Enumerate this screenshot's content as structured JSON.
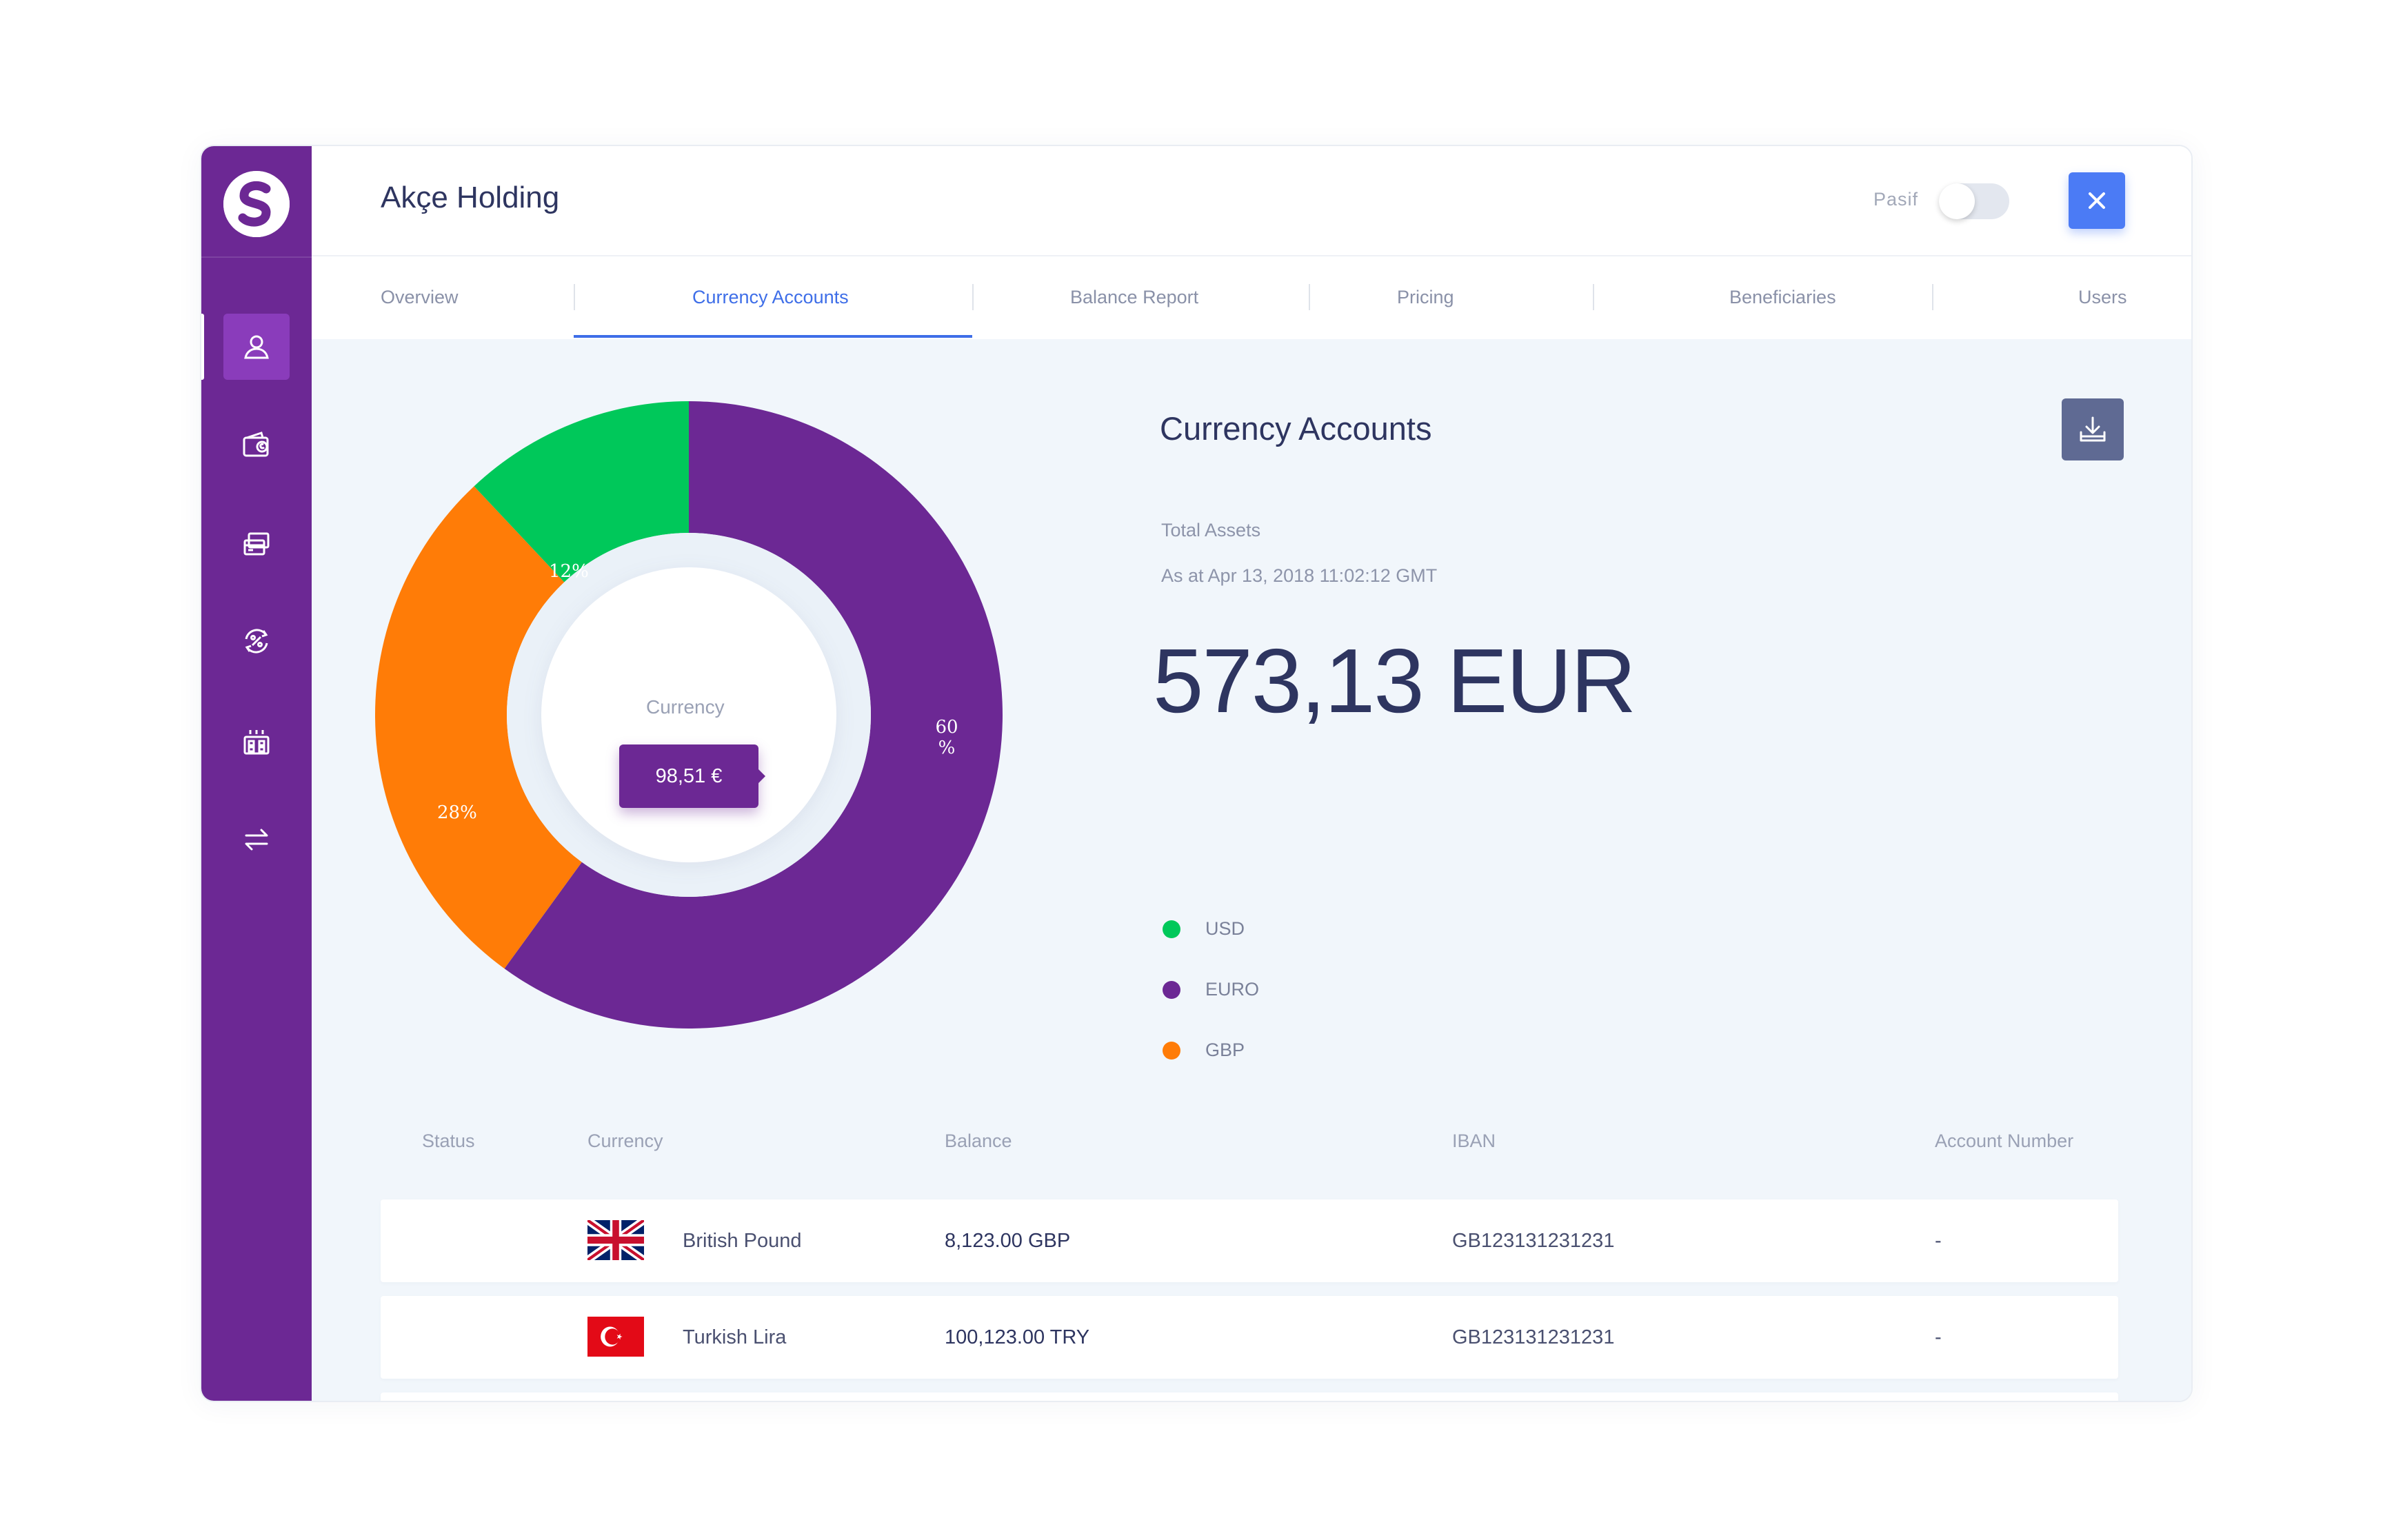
{
  "app": {
    "company_name": "Akçe Holding",
    "status_label": "Pasif",
    "status_active": false
  },
  "sidebar": {
    "items": [
      {
        "icon": "user-icon",
        "active": true
      },
      {
        "icon": "wallet-icon",
        "active": false
      },
      {
        "icon": "cards-icon",
        "active": false
      },
      {
        "icon": "percent-exchange-icon",
        "active": false
      },
      {
        "icon": "building-icon",
        "active": false
      },
      {
        "icon": "transfer-arrows-icon",
        "active": false
      }
    ]
  },
  "tabs": [
    {
      "label": "Overview",
      "active": false
    },
    {
      "label": "Currency Accounts",
      "active": true
    },
    {
      "label": "Balance Report",
      "active": false
    },
    {
      "label": "Pricing",
      "active": false
    },
    {
      "label": "Beneficiaries",
      "active": false
    },
    {
      "label": "Users",
      "active": false
    }
  ],
  "panel": {
    "title": "Currency Accounts",
    "total_assets_label": "Total Assets",
    "as_at": "As at Apr 13, 2018 11:02:12 GMT",
    "total_amount": "573,13 EUR",
    "legend": [
      {
        "label": "USD",
        "color": "#00c85a"
      },
      {
        "label": "EURO",
        "color": "#6c2894"
      },
      {
        "label": "GBP",
        "color": "#ff7c07"
      }
    ]
  },
  "donut": {
    "center_caption": "Currency",
    "center_value": "98,51 €",
    "slices": [
      {
        "name": "EURO",
        "value": 60,
        "color": "#6c2894",
        "label_line1": "60",
        "label_line2": "%"
      },
      {
        "name": "GBP",
        "value": 28,
        "color": "#ff7c07",
        "label_line1": "28%",
        "label_line2": ""
      },
      {
        "name": "USD",
        "value": 12,
        "color": "#00c85a",
        "label_line1": "12%",
        "label_line2": ""
      }
    ]
  },
  "table": {
    "headers": [
      "Status",
      "Currency",
      "Balance",
      "IBAN",
      "Account Number"
    ],
    "rows": [
      {
        "currency": "British Pound",
        "flag": "uk-flag-icon",
        "balance": "8,123.00 GBP",
        "iban": "GB123131231231",
        "account_number": "-"
      },
      {
        "currency": "Turkish Lira",
        "flag": "turkey-flag-icon",
        "balance": "100,123.00 TRY",
        "iban": "GB123131231231",
        "account_number": "-"
      }
    ]
  },
  "colors": {
    "brand_purple": "#6c2894",
    "accent_blue": "#3e6ee8",
    "close_button": "#4b7bf5",
    "download_button": "#5f6a93"
  }
}
